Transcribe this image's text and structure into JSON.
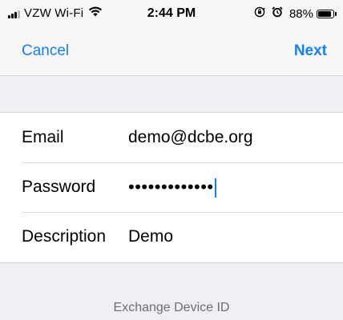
{
  "status_bar": {
    "carrier": "VZW Wi-Fi",
    "time": "2:44 PM",
    "battery": "88%",
    "battery_level": 0.88,
    "icons": [
      "signal-icon",
      "wifi-icon",
      "orientation-lock-icon",
      "alarm-icon",
      "battery-icon"
    ]
  },
  "nav": {
    "cancel_label": "Cancel",
    "next_label": "Next",
    "accent_color": "#157efb"
  },
  "form": {
    "email": {
      "label": "Email",
      "value": "demo@dcbe.org"
    },
    "password": {
      "label": "Password",
      "value": "•••••••••••••"
    },
    "description": {
      "label": "Description",
      "value": "Demo"
    }
  },
  "footer": {
    "label": "Exchange Device ID"
  }
}
